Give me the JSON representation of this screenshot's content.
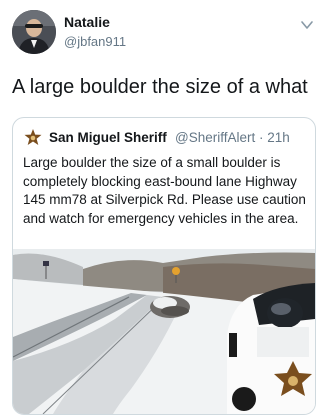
{
  "author": {
    "name": "Natalie",
    "handle": "@jbfan911"
  },
  "tweet": {
    "text": "A large boulder the size of a what"
  },
  "quoted": {
    "name": "San Miguel Sheriff",
    "handle": "@SheriffAlert · 21h",
    "text": "Large boulder the size of a small boulder is completely blocking east-bound lane Highway 145 mm78 at Silverpick Rd. Please use caution and watch for emergency vehicles in the area."
  },
  "icons": {
    "menu": "chevron-down-icon",
    "badge": "sheriff-star-icon"
  },
  "colors": {
    "text": "#14171a",
    "muted": "#657786",
    "border": "#cfd9de",
    "badge": "#7a4e1e"
  }
}
